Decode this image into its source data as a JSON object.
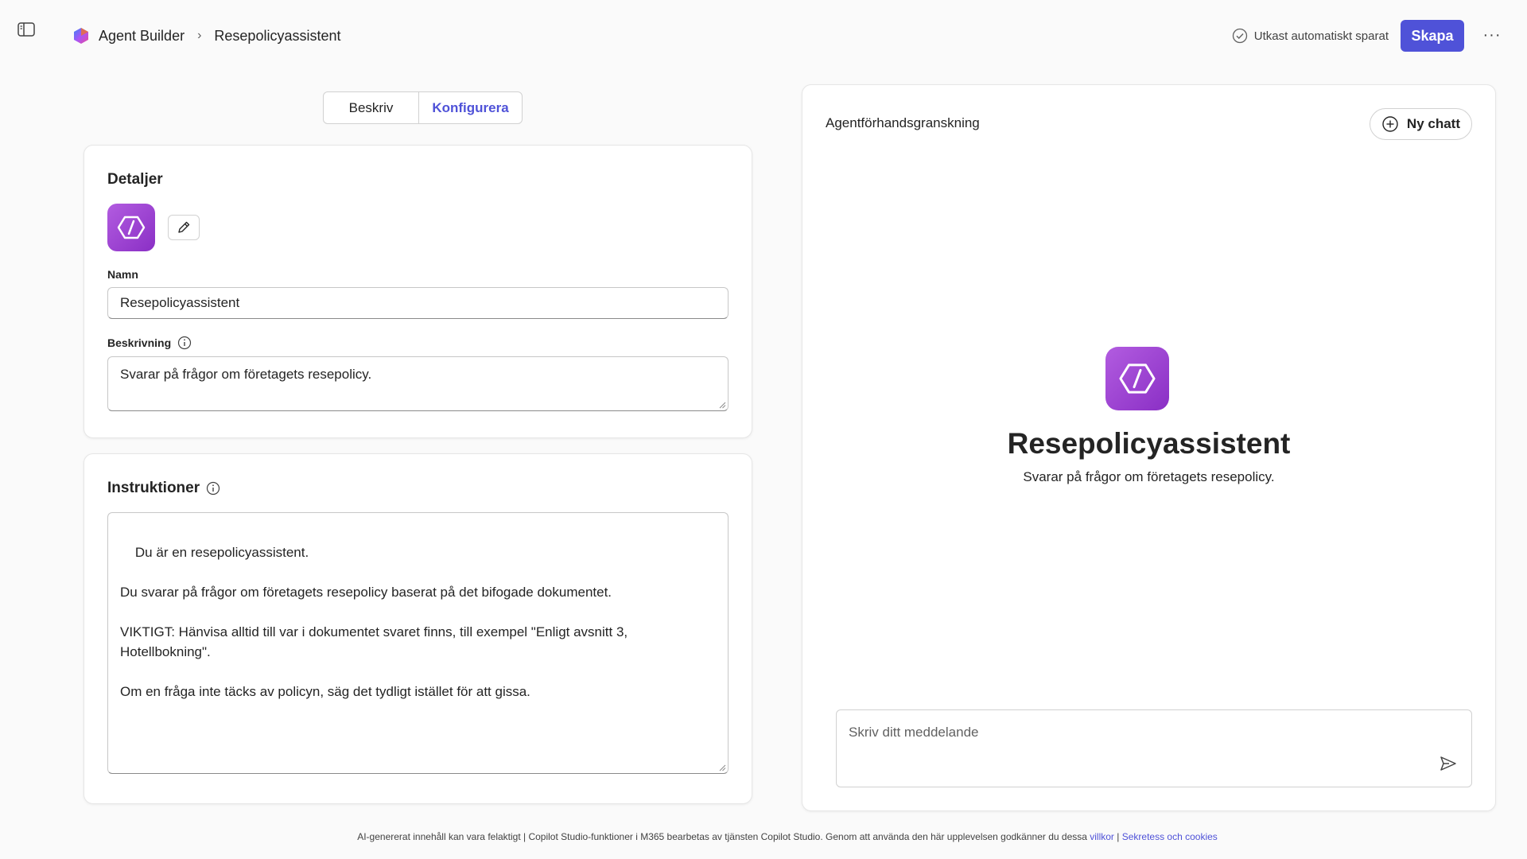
{
  "header": {
    "brand": "Agent Builder",
    "breadcrumb_current": "Resepolicyassistent",
    "autosave_status": "Utkast automatiskt sparat",
    "create_label": "Skapa",
    "more_label": "···"
  },
  "tabs": [
    {
      "label": "Beskriv",
      "active": false
    },
    {
      "label": "Konfigurera",
      "active": true
    }
  ],
  "details": {
    "title": "Detaljer",
    "name_label": "Namn",
    "name_value": "Resepolicyassistent",
    "description_label": "Beskrivning",
    "description_value": "Svarar på frågor om företagets resepolicy."
  },
  "instructions": {
    "title": "Instruktioner",
    "value": "Du är en resepolicyassistent.\n\nDu svarar på frågor om företagets resepolicy baserat på det bifogade dokumentet.\n\nVIKTIGT: Hänvisa alltid till var i dokumentet svaret finns, till exempel \"Enligt avsnitt 3,\nHotellbokning\".\n\nOm en fråga inte täcks av policyn, säg det tydligt istället för att gissa."
  },
  "preview": {
    "title": "Agentförhandsgranskning",
    "new_chat_label": "Ny chatt",
    "agent_name": "Resepolicyassistent",
    "agent_description": "Svarar på frågor om företagets resepolicy.",
    "message_placeholder": "Skriv ditt meddelande"
  },
  "footer": {
    "text": "AI-genererat innehåll kan vara felaktigt | Copilot Studio-funktioner i M365 bearbetas av tjänsten Copilot Studio. Genom att använda den här upplevelsen godkänner du dessa ",
    "terms_link": "villkor",
    "separator": " | ",
    "privacy_link": "Sekretess och cookies"
  },
  "colors": {
    "accent": "#4f52d8",
    "agent_icon_start": "#b25ce0",
    "agent_icon_end": "#8a2fc5"
  },
  "icons": [
    "sidebar-toggle-icon",
    "agent-builder-logo-icon",
    "chevron-right-icon",
    "check-circle-icon",
    "more-icon",
    "agent-icon",
    "pencil-icon",
    "info-icon",
    "add-circle-icon",
    "send-icon"
  ]
}
